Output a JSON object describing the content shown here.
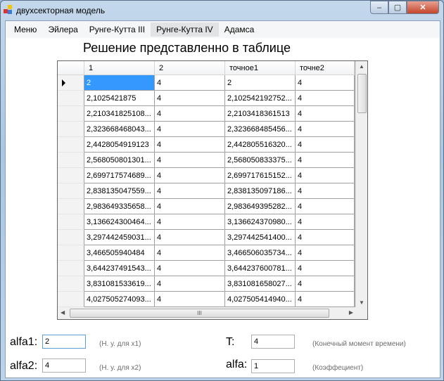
{
  "window": {
    "title": "двухсекторная модель",
    "minimize": "‒",
    "maximize": "▢",
    "close": "✕"
  },
  "menu": [
    {
      "label": "Меню"
    },
    {
      "label": "Эйлера"
    },
    {
      "label": "Рунге-Кутта III"
    },
    {
      "label": "Рунге-Кутта IV",
      "active": true
    },
    {
      "label": "Адамса"
    }
  ],
  "heading": "Решение представленно в таблице",
  "table": {
    "columns": [
      "1",
      "2",
      "точное1",
      "точне2"
    ],
    "rows": [
      [
        "2",
        "4",
        "2",
        "4"
      ],
      [
        "2,1025421875",
        "4",
        "2,102542192752...",
        "4"
      ],
      [
        "2,210341825108...",
        "4",
        "2,2103418361513",
        "4"
      ],
      [
        "2,323668468043...",
        "4",
        "2,323668485456...",
        "4"
      ],
      [
        "2,4428054919123",
        "4",
        "2,442805516320...",
        "4"
      ],
      [
        "2,568050801301...",
        "4",
        "2,568050833375...",
        "4"
      ],
      [
        "2,699717574689...",
        "4",
        "2,699717615152...",
        "4"
      ],
      [
        "2,838135047559...",
        "4",
        "2,838135097186...",
        "4"
      ],
      [
        "2,983649335658...",
        "4",
        "2,983649395282...",
        "4"
      ],
      [
        "3,136624300464...",
        "4",
        "3,136624370980...",
        "4"
      ],
      [
        "3,297442459031...",
        "4",
        "3,297442541400...",
        "4"
      ],
      [
        "3,466505940484",
        "4",
        "3,466506035734...",
        "4"
      ],
      [
        "3,644237491543...",
        "4",
        "3,644237600781...",
        "4"
      ],
      [
        "3,831081533619...",
        "4",
        "3,831081658027...",
        "4"
      ],
      [
        "4,027505274093...",
        "4",
        "4,027505414940...",
        "4"
      ]
    ],
    "hscroll_grip": "III"
  },
  "form": {
    "alfa1": {
      "label": "alfa1:",
      "value": "2",
      "hint": "(Н. у. для x1)"
    },
    "alfa2": {
      "label": "alfa2:",
      "value": "4",
      "hint": "(Н. у. для x2)"
    },
    "T": {
      "label": "T:",
      "value": "4",
      "hint": "(Конечный момент времени)"
    },
    "alfa": {
      "label": "alfa:",
      "value": "1",
      "hint": "(Коэффециент)"
    }
  }
}
